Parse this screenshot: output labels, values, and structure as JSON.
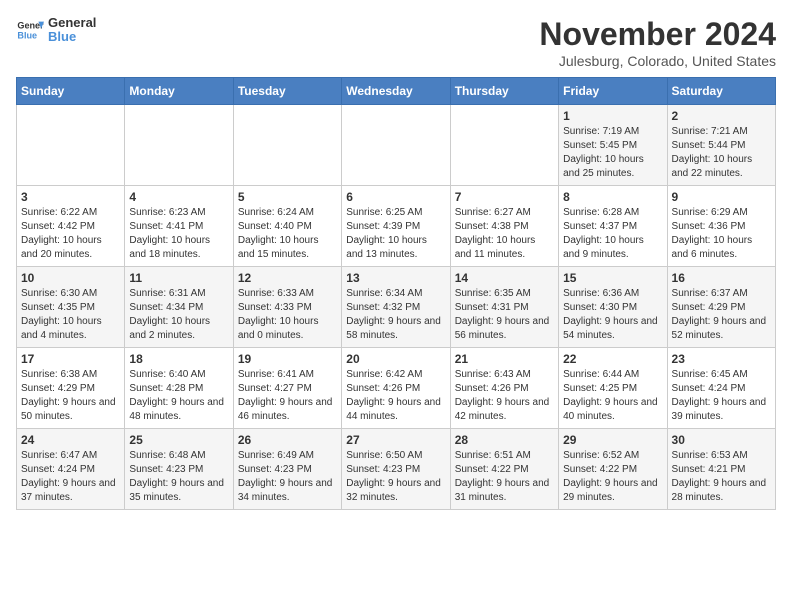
{
  "header": {
    "logo_general": "General",
    "logo_blue": "Blue",
    "month_title": "November 2024",
    "location": "Julesburg, Colorado, United States"
  },
  "weekdays": [
    "Sunday",
    "Monday",
    "Tuesday",
    "Wednesday",
    "Thursday",
    "Friday",
    "Saturday"
  ],
  "weeks": [
    [
      {
        "day": "",
        "info": ""
      },
      {
        "day": "",
        "info": ""
      },
      {
        "day": "",
        "info": ""
      },
      {
        "day": "",
        "info": ""
      },
      {
        "day": "",
        "info": ""
      },
      {
        "day": "1",
        "info": "Sunrise: 7:19 AM\nSunset: 5:45 PM\nDaylight: 10 hours and 25 minutes."
      },
      {
        "day": "2",
        "info": "Sunrise: 7:21 AM\nSunset: 5:44 PM\nDaylight: 10 hours and 22 minutes."
      }
    ],
    [
      {
        "day": "3",
        "info": "Sunrise: 6:22 AM\nSunset: 4:42 PM\nDaylight: 10 hours and 20 minutes."
      },
      {
        "day": "4",
        "info": "Sunrise: 6:23 AM\nSunset: 4:41 PM\nDaylight: 10 hours and 18 minutes."
      },
      {
        "day": "5",
        "info": "Sunrise: 6:24 AM\nSunset: 4:40 PM\nDaylight: 10 hours and 15 minutes."
      },
      {
        "day": "6",
        "info": "Sunrise: 6:25 AM\nSunset: 4:39 PM\nDaylight: 10 hours and 13 minutes."
      },
      {
        "day": "7",
        "info": "Sunrise: 6:27 AM\nSunset: 4:38 PM\nDaylight: 10 hours and 11 minutes."
      },
      {
        "day": "8",
        "info": "Sunrise: 6:28 AM\nSunset: 4:37 PM\nDaylight: 10 hours and 9 minutes."
      },
      {
        "day": "9",
        "info": "Sunrise: 6:29 AM\nSunset: 4:36 PM\nDaylight: 10 hours and 6 minutes."
      }
    ],
    [
      {
        "day": "10",
        "info": "Sunrise: 6:30 AM\nSunset: 4:35 PM\nDaylight: 10 hours and 4 minutes."
      },
      {
        "day": "11",
        "info": "Sunrise: 6:31 AM\nSunset: 4:34 PM\nDaylight: 10 hours and 2 minutes."
      },
      {
        "day": "12",
        "info": "Sunrise: 6:33 AM\nSunset: 4:33 PM\nDaylight: 10 hours and 0 minutes."
      },
      {
        "day": "13",
        "info": "Sunrise: 6:34 AM\nSunset: 4:32 PM\nDaylight: 9 hours and 58 minutes."
      },
      {
        "day": "14",
        "info": "Sunrise: 6:35 AM\nSunset: 4:31 PM\nDaylight: 9 hours and 56 minutes."
      },
      {
        "day": "15",
        "info": "Sunrise: 6:36 AM\nSunset: 4:30 PM\nDaylight: 9 hours and 54 minutes."
      },
      {
        "day": "16",
        "info": "Sunrise: 6:37 AM\nSunset: 4:29 PM\nDaylight: 9 hours and 52 minutes."
      }
    ],
    [
      {
        "day": "17",
        "info": "Sunrise: 6:38 AM\nSunset: 4:29 PM\nDaylight: 9 hours and 50 minutes."
      },
      {
        "day": "18",
        "info": "Sunrise: 6:40 AM\nSunset: 4:28 PM\nDaylight: 9 hours and 48 minutes."
      },
      {
        "day": "19",
        "info": "Sunrise: 6:41 AM\nSunset: 4:27 PM\nDaylight: 9 hours and 46 minutes."
      },
      {
        "day": "20",
        "info": "Sunrise: 6:42 AM\nSunset: 4:26 PM\nDaylight: 9 hours and 44 minutes."
      },
      {
        "day": "21",
        "info": "Sunrise: 6:43 AM\nSunset: 4:26 PM\nDaylight: 9 hours and 42 minutes."
      },
      {
        "day": "22",
        "info": "Sunrise: 6:44 AM\nSunset: 4:25 PM\nDaylight: 9 hours and 40 minutes."
      },
      {
        "day": "23",
        "info": "Sunrise: 6:45 AM\nSunset: 4:24 PM\nDaylight: 9 hours and 39 minutes."
      }
    ],
    [
      {
        "day": "24",
        "info": "Sunrise: 6:47 AM\nSunset: 4:24 PM\nDaylight: 9 hours and 37 minutes."
      },
      {
        "day": "25",
        "info": "Sunrise: 6:48 AM\nSunset: 4:23 PM\nDaylight: 9 hours and 35 minutes."
      },
      {
        "day": "26",
        "info": "Sunrise: 6:49 AM\nSunset: 4:23 PM\nDaylight: 9 hours and 34 minutes."
      },
      {
        "day": "27",
        "info": "Sunrise: 6:50 AM\nSunset: 4:23 PM\nDaylight: 9 hours and 32 minutes."
      },
      {
        "day": "28",
        "info": "Sunrise: 6:51 AM\nSunset: 4:22 PM\nDaylight: 9 hours and 31 minutes."
      },
      {
        "day": "29",
        "info": "Sunrise: 6:52 AM\nSunset: 4:22 PM\nDaylight: 9 hours and 29 minutes."
      },
      {
        "day": "30",
        "info": "Sunrise: 6:53 AM\nSunset: 4:21 PM\nDaylight: 9 hours and 28 minutes."
      }
    ]
  ]
}
